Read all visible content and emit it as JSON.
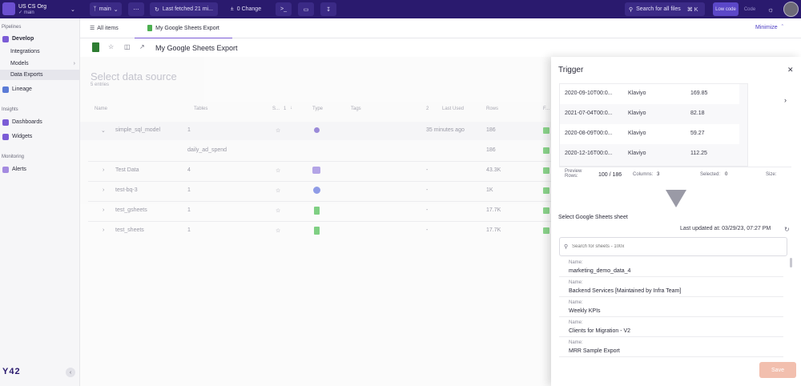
{
  "topbar": {
    "org_name": "US CS Org",
    "org_branch": "✓ main",
    "branch_label": "main",
    "fetch_label": "Last fetched 21 mi...",
    "change_label": "0 Change",
    "search_label": "Search for all files",
    "search_shortcut": "⌘ K",
    "low_code_label": "Low code",
    "code_label": "Code"
  },
  "sidebar": {
    "sec_pipelines": "Pipelines",
    "develop": "Develop",
    "integrations": "Integrations",
    "models": "Models",
    "data_exports": "Data Exports",
    "lineage": "Lineage",
    "sec_insights": "Insights",
    "dashboards": "Dashboards",
    "widgets": "Widgets",
    "sec_monitoring": "Monitoring",
    "alerts": "Alerts",
    "logo": "Y42"
  },
  "tabs": {
    "all_items": "All items",
    "export_tab": "My Google Sheets Export",
    "minimize": "Minimize"
  },
  "header": {
    "title": "My Google Sheets Export"
  },
  "source": {
    "title": "Select data source",
    "entries": "5 entries",
    "columns": {
      "name": "Name",
      "tables": "Tables",
      "s": "S...",
      "sort_num": "1",
      "type": "Type",
      "tags": "Tags",
      "last_used_num": "2",
      "last_used": "Last Used",
      "rows": "Rows",
      "f": "F..."
    },
    "rows": [
      {
        "name": "simple_sql_model",
        "tables": "1",
        "last_used": "35 minutes ago",
        "rows": "186"
      },
      {
        "name": "",
        "tables": "daily_ad_spend",
        "last_used": "",
        "rows": "186"
      },
      {
        "name": "Test Data",
        "tables": "4",
        "last_used": "-",
        "rows": "43.3K"
      },
      {
        "name": "test-bq-3",
        "tables": "1",
        "last_used": "-",
        "rows": "1K"
      },
      {
        "name": "test_gsheets",
        "tables": "1",
        "last_used": "-",
        "rows": "17.7K"
      },
      {
        "name": "test_sheets",
        "tables": "1",
        "last_used": "-",
        "rows": "17.7K"
      }
    ]
  },
  "panel": {
    "title": "Trigger",
    "preview_rows": [
      {
        "date": "2020-09-10T00:0...",
        "source": "Klaviyo",
        "value": "169.85"
      },
      {
        "date": "2021-07-04T00:0...",
        "source": "Klaviyo",
        "value": "82.18"
      },
      {
        "date": "2020-08-09T00:0...",
        "source": "Klaviyo",
        "value": "59.27"
      },
      {
        "date": "2020-12-16T00:0...",
        "source": "Klaviyo",
        "value": "112.25"
      }
    ],
    "preview_label": "Preview Rows:",
    "preview_count": "100 / 186",
    "columns_label": "Columns:",
    "columns_value": "3",
    "selected_label": "Selected:",
    "selected_value": "0",
    "size_label": "Size:",
    "select_sheet_label": "Select Google Sheets sheet",
    "last_updated": "Last updated at: 03/29/23, 07:27 PM",
    "search_placeholder": "Search for sheets - 100x",
    "name_label": "Name:",
    "sheets": [
      "marketing_demo_data_4",
      "Backend Services [Maintained by Infra Team]",
      "Weekly KPIs",
      "Clients for Migration - V2",
      "MRR Sample Export"
    ],
    "save_label": "Save"
  },
  "colors": {
    "brand": "#2a1a6e",
    "accent": "#7b5cd6",
    "save": "#f2bfae",
    "check": "#8bd48b"
  }
}
